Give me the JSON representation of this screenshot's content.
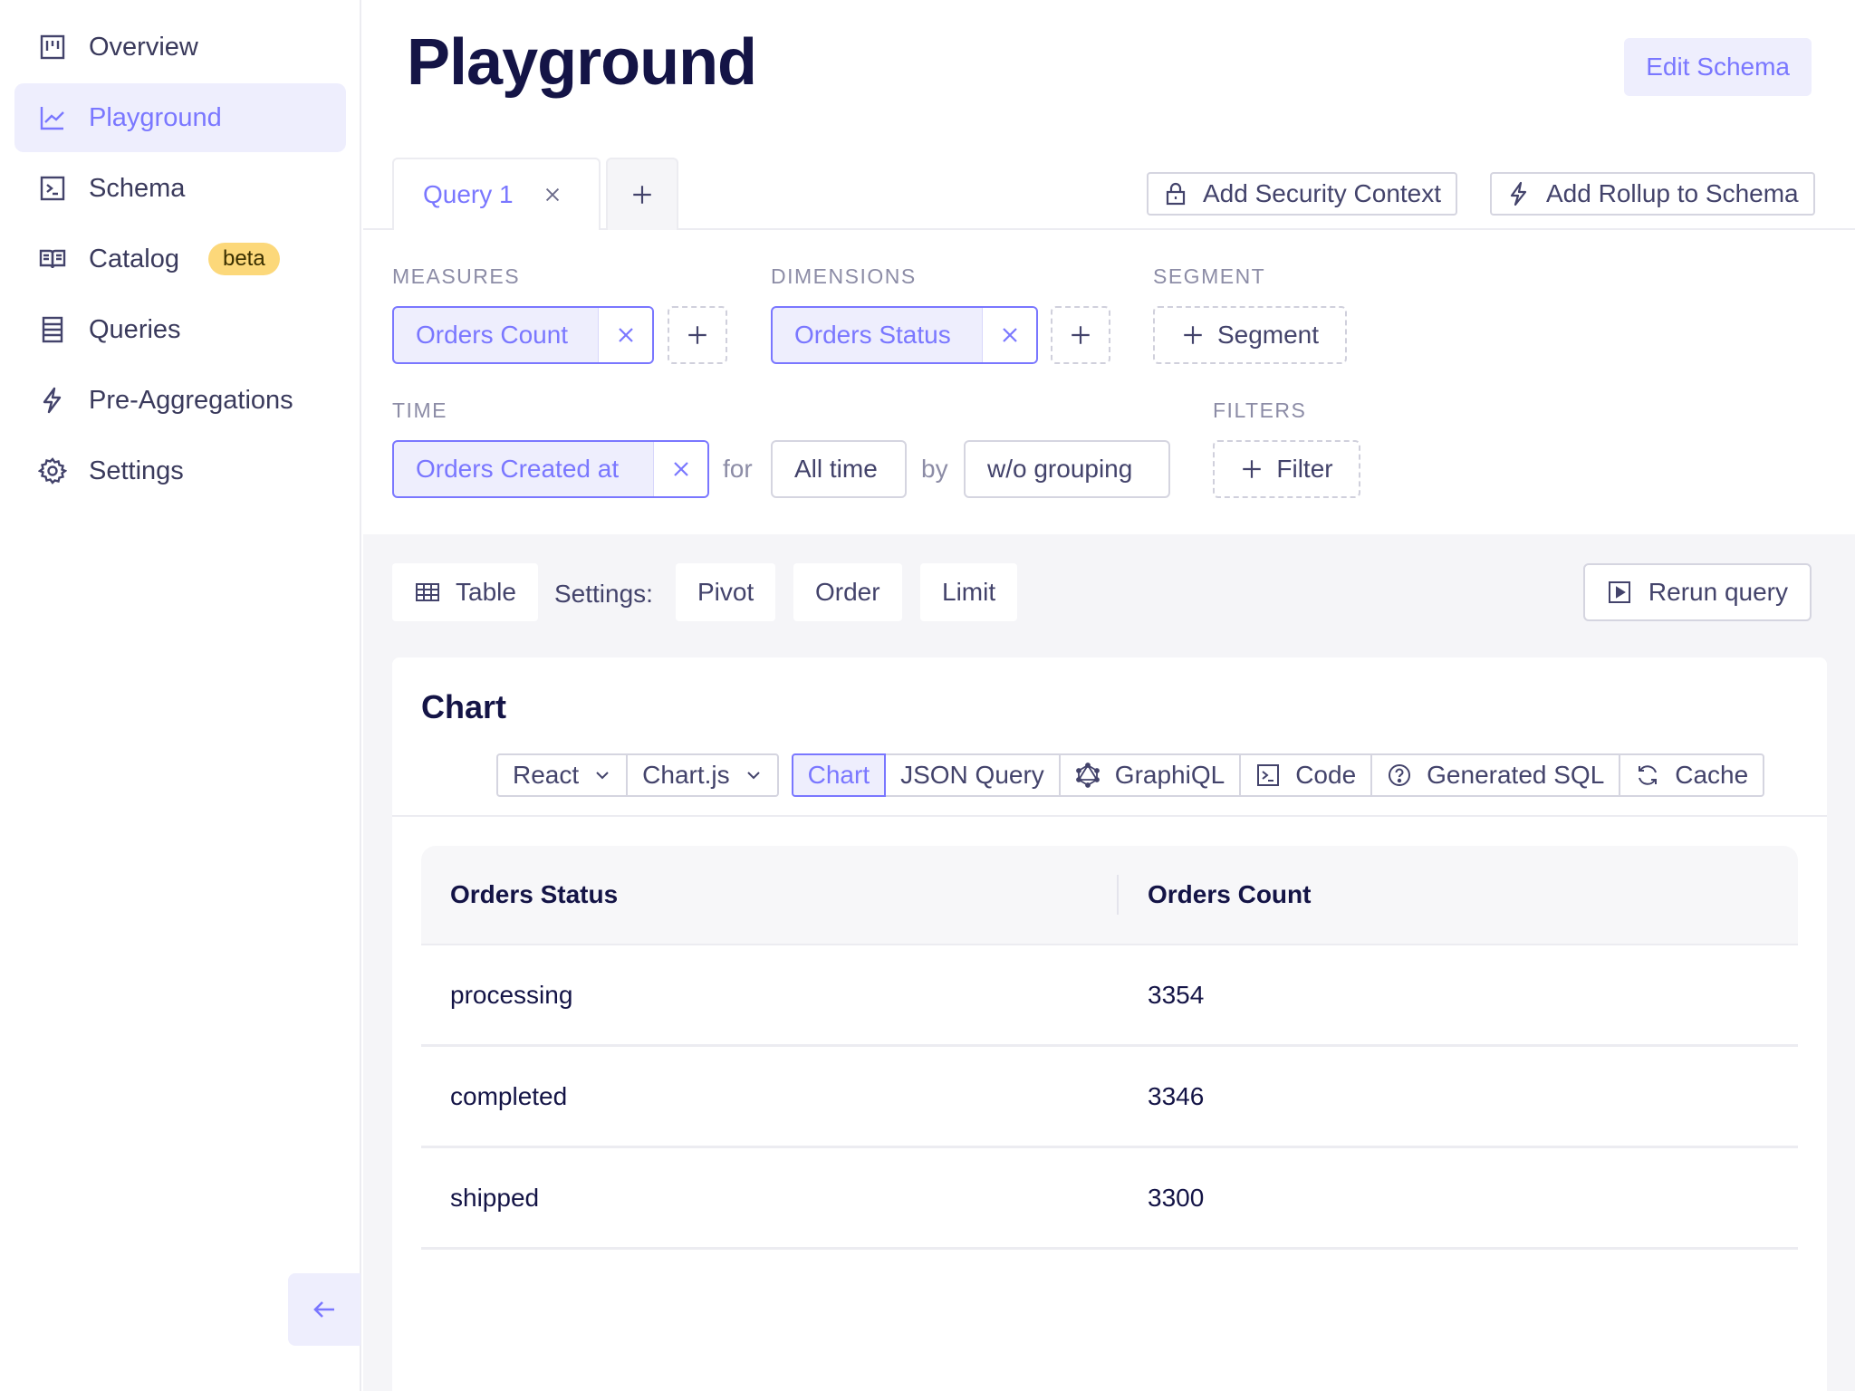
{
  "sidebar": {
    "items": [
      {
        "label": "Overview",
        "icon": "overview-icon"
      },
      {
        "label": "Playground",
        "icon": "chart-line-icon",
        "active": true
      },
      {
        "label": "Schema",
        "icon": "terminal-icon"
      },
      {
        "label": "Catalog",
        "icon": "book-icon",
        "badge": "beta"
      },
      {
        "label": "Queries",
        "icon": "list-icon"
      },
      {
        "label": "Pre-Aggregations",
        "icon": "lightning-icon"
      },
      {
        "label": "Settings",
        "icon": "gear-icon"
      }
    ]
  },
  "header": {
    "title": "Playground",
    "edit_schema": "Edit Schema"
  },
  "tabs": {
    "query_tab": "Query 1",
    "add_security_context": "Add Security Context",
    "add_rollup": "Add Rollup to Schema"
  },
  "builder": {
    "measures_label": "MEASURES",
    "dimensions_label": "DIMENSIONS",
    "segment_label": "SEGMENT",
    "time_label": "TIME",
    "filters_label": "FILTERS",
    "measure_chip": "Orders Count",
    "dimension_chip": "Orders Status",
    "segment_btn": "Segment",
    "time_chip": "Orders Created at",
    "for_text": "for",
    "date_range": "All time",
    "by_text": "by",
    "granularity": "w/o grouping",
    "filter_btn": "Filter"
  },
  "toolbar": {
    "table": "Table",
    "settings_label": "Settings:",
    "pivot": "Pivot",
    "order": "Order",
    "limit": "Limit",
    "rerun": "Rerun query"
  },
  "card": {
    "title": "Chart",
    "framework": "React",
    "library": "Chart.js",
    "tabs": [
      "Chart",
      "JSON Query",
      "GraphiQL",
      "Code",
      "Generated SQL",
      "Cache"
    ]
  },
  "table": {
    "columns": [
      "Orders Status",
      "Orders Count"
    ],
    "rows": [
      [
        "processing",
        "3354"
      ],
      [
        "completed",
        "3346"
      ],
      [
        "shipped",
        "3300"
      ]
    ]
  },
  "colors": {
    "accent": "#7a77ff",
    "accent_bg": "#eeeefd",
    "text_dark": "#141446",
    "badge": "#fcd87a"
  }
}
